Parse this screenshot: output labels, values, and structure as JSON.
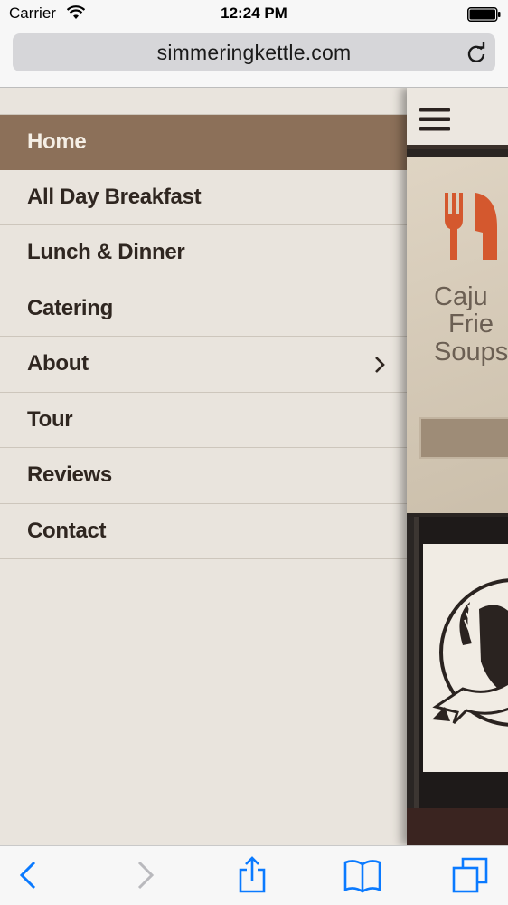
{
  "status_bar": {
    "carrier": "Carrier",
    "time": "12:24 PM"
  },
  "url_bar": {
    "url": "simmeringkettle.com"
  },
  "menu": {
    "items": [
      {
        "label": "Home",
        "active": true
      },
      {
        "label": "All Day Breakfast"
      },
      {
        "label": "Lunch & Dinner"
      },
      {
        "label": "Catering"
      },
      {
        "label": "About",
        "has_submenu": true
      },
      {
        "label": "Tour"
      },
      {
        "label": "Reviews"
      },
      {
        "label": "Contact"
      }
    ]
  },
  "site_peek": {
    "tagline_lines": [
      "Caju",
      "Frie",
      "Soups"
    ]
  },
  "colors": {
    "menu_background": "#e9e4dd",
    "menu_active": "#8c7059",
    "menu_text": "#2f2620",
    "accent_icon": "#d4582e",
    "ios_blue": "#0a7aff"
  },
  "icons": {
    "wifi": "wifi-icon",
    "battery": "battery-icon",
    "reload": "reload-icon",
    "hamburger": "hamburger-icon",
    "fork_knife": "fork-knife-icon",
    "back": "chevron-left-icon",
    "forward": "chevron-right-icon",
    "share": "share-icon",
    "bookmarks": "book-icon",
    "tabs": "tabs-icon"
  }
}
